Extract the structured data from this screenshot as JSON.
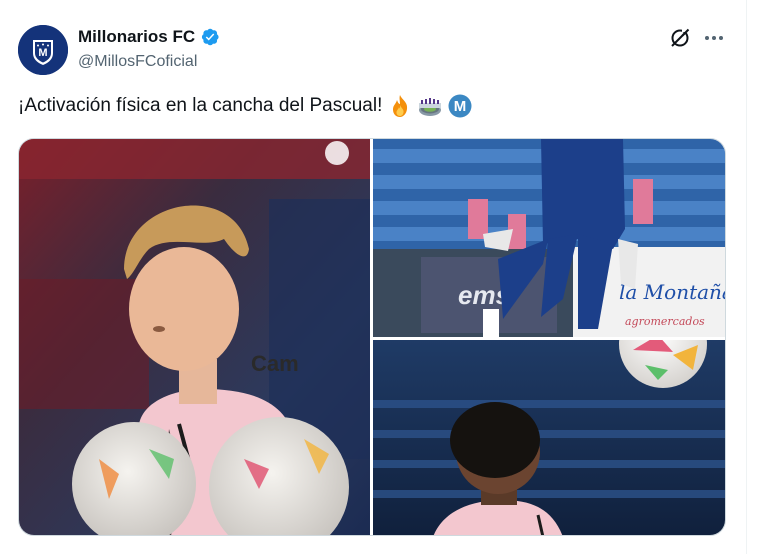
{
  "tweet": {
    "display_name": "Millonarios FC",
    "handle": "@MillosFCoficial",
    "text": "¡Activación física en la cancha del Pascual!",
    "emojis": [
      "fire-emoji",
      "stadium-emoji",
      "circled-m-emoji"
    ],
    "verified": true
  },
  "media": {
    "photos": [
      {
        "description_icon": "player-warmup-photo",
        "shirt_sponsor": "Cam"
      },
      {
        "description_icon": "goalkeeper-photo",
        "ad_board_left": "ems",
        "ad_board_right": "la Montaña",
        "ad_board_right_sub": "agromercados"
      },
      {
        "description_icon": "player-ball-photo"
      }
    ]
  },
  "colors": {
    "brand_blue": "#14337a",
    "verified_blue": "#1d9bf0",
    "text_primary": "#0f1419",
    "text_secondary": "#536471"
  }
}
